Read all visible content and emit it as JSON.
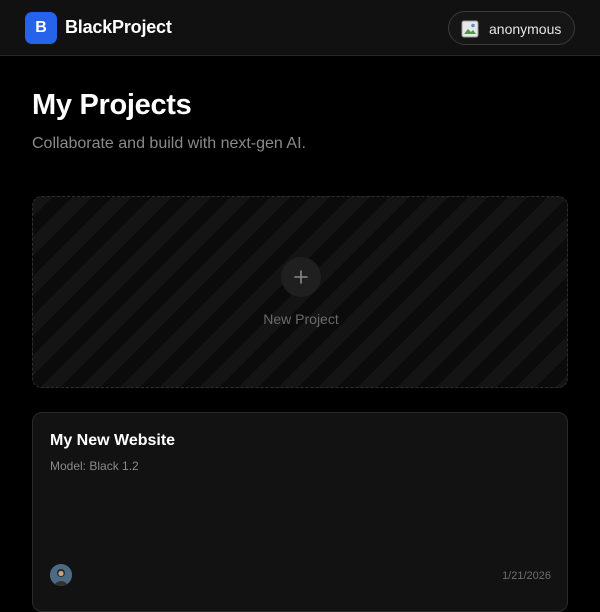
{
  "header": {
    "logo_letter": "B",
    "brand": "BlackProject",
    "user_name": "anonymous"
  },
  "main": {
    "title": "My Projects",
    "subtitle": "Collaborate and build with next-gen AI.",
    "new_project_label": "New Project"
  },
  "projects": [
    {
      "title": "My New Website",
      "model": "Model: Black 1.2",
      "date": "1/21/2026"
    }
  ],
  "colors": {
    "accent": "#2563eb",
    "background": "#000000",
    "surface": "#121212"
  },
  "icons": {
    "user": "broken-image-avatar-icon",
    "add": "plus-icon",
    "owner": "avatar-photo-icon"
  }
}
